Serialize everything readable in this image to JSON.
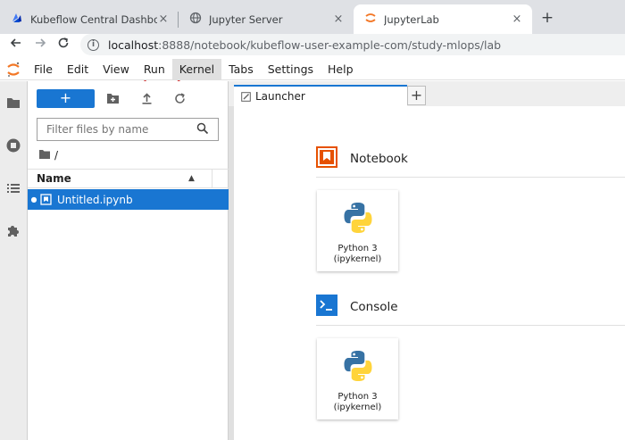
{
  "browser": {
    "tabs": [
      {
        "title": "Kubeflow Central Dashboard",
        "close": "×"
      },
      {
        "title": "Jupyter Server",
        "close": "×"
      },
      {
        "title": "JupyterLab",
        "close": "×"
      }
    ],
    "new_tab": "+",
    "url": {
      "host": "localhost",
      "port": ":8888",
      "path": "/notebook/kubeflow-user-example-com/study-mlops/lab"
    },
    "annotation_color": "#d32f2f"
  },
  "jupyter": {
    "menu": [
      {
        "label": "File"
      },
      {
        "label": "Edit"
      },
      {
        "label": "View"
      },
      {
        "label": "Run"
      },
      {
        "label": "Kernel"
      },
      {
        "label": "Tabs"
      },
      {
        "label": "Settings"
      },
      {
        "label": "Help"
      }
    ],
    "active_menu": "Kernel",
    "file_browser": {
      "new_label": "+",
      "filter_placeholder": "Filter files by name",
      "breadcrumb": "/",
      "column_name": "Name",
      "files": [
        {
          "name": "Untitled.ipynb",
          "selected": true
        }
      ]
    },
    "launcher": {
      "tab_title": "Launcher",
      "add_tab": "+",
      "sections": [
        {
          "title": "Notebook",
          "card": {
            "line1": "Python 3",
            "line2": "(ipykernel)"
          }
        },
        {
          "title": "Console",
          "card": {
            "line1": "Python 3",
            "line2": "(ipykernel)"
          }
        }
      ]
    },
    "colors": {
      "brand_blue": "#1976d2",
      "notebook_orange": "#e65100",
      "jupyter_orange": "#f37726"
    }
  }
}
